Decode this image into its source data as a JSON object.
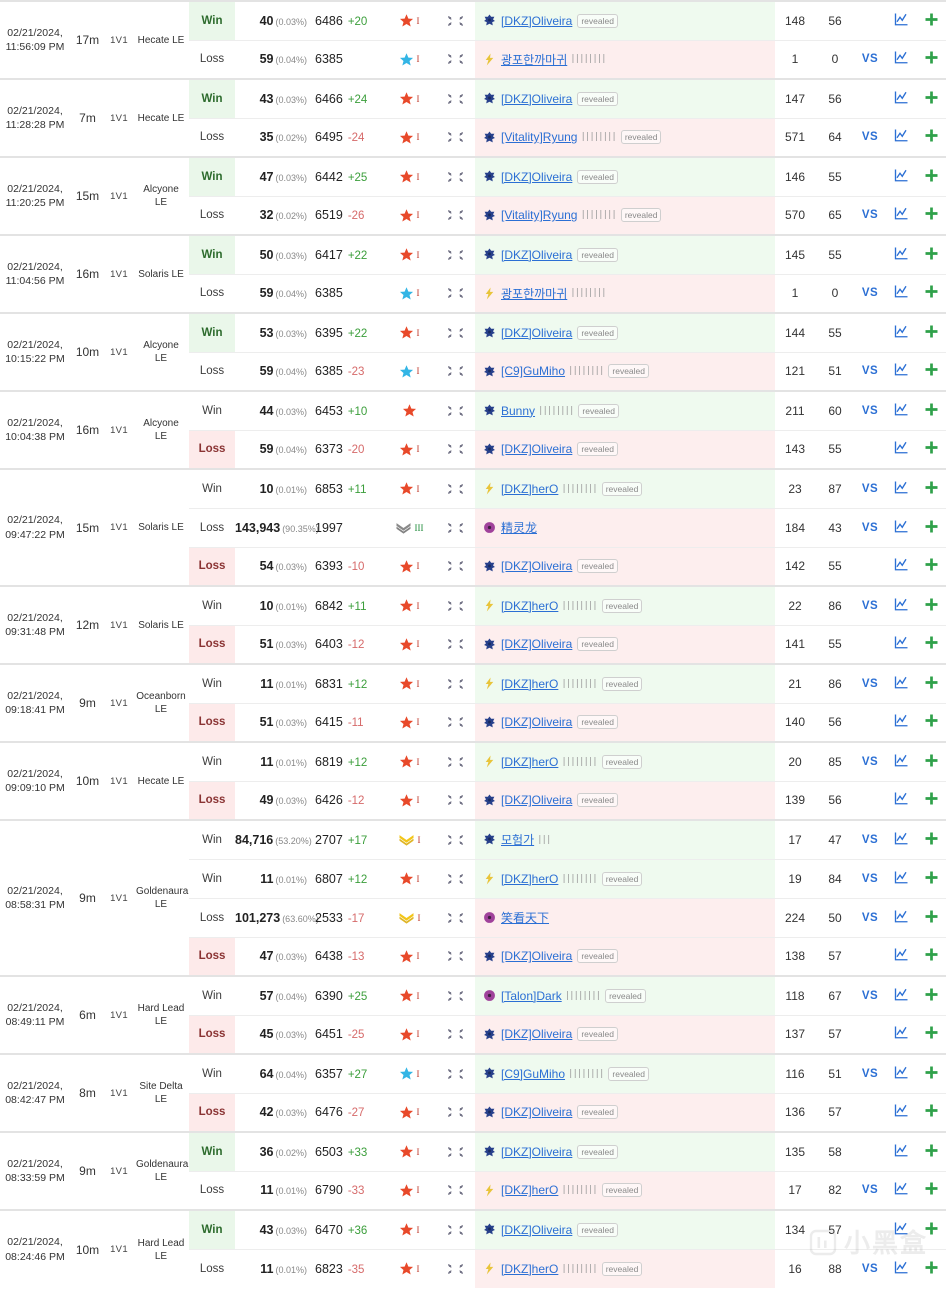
{
  "labels": {
    "win": "Win",
    "loss": "Loss",
    "mode": "1V1",
    "vs": "VS",
    "revealed": "revealed",
    "bars": "||||||||||",
    "bars_short": "|||"
  },
  "colors": {
    "win_bg": "#eaf7ea",
    "loss_bg": "#fdeaea",
    "link": "#2b6fd4",
    "mmr_up": "#3b9e3b",
    "mmr_down": "#d66a6a",
    "grandmaster": "#e8492a",
    "master": "#33b5e5",
    "gold": "#f2c518",
    "silver": "#8a8a8a",
    "add": "#2fa14a"
  },
  "watermark": {
    "text": "小黑盒"
  },
  "matches": [
    {
      "date": "02/21/2024, 11:56:09 PM",
      "duration": "17m",
      "mode": "1V1",
      "map": "Hecate LE",
      "rows": [
        {
          "result": "Win",
          "result_style": "win",
          "rank": "40",
          "pct": "(0.03%)",
          "mmr": "6486",
          "delta": "+20",
          "league": "grandmaster",
          "tier": "I",
          "tier_color": "red",
          "flag": "kr",
          "race": "terran",
          "player": "[DKZ]Oliveira",
          "bars": "",
          "revealed": true,
          "games": "148",
          "winrate": "56",
          "vs": false,
          "player_bg": "win"
        },
        {
          "result": "Loss",
          "result_style": "plain",
          "rank": "59",
          "pct": "(0.04%)",
          "mmr": "6385",
          "delta": "",
          "league": "master",
          "tier": "I",
          "tier_color": "red",
          "flag": "kr",
          "race": "protoss",
          "player": "광포한까마귀",
          "bars": "||||||||",
          "revealed": false,
          "games": "1",
          "winrate": "0",
          "vs": true,
          "player_bg": "loss"
        }
      ]
    },
    {
      "date": "02/21/2024, 11:28:28 PM",
      "duration": "7m",
      "mode": "1V1",
      "map": "Hecate LE",
      "rows": [
        {
          "result": "Win",
          "result_style": "win",
          "rank": "43",
          "pct": "(0.03%)",
          "mmr": "6466",
          "delta": "+24",
          "league": "grandmaster",
          "tier": "I",
          "tier_color": "red",
          "flag": "kr",
          "race": "terran",
          "player": "[DKZ]Oliveira",
          "bars": "",
          "revealed": true,
          "games": "147",
          "winrate": "56",
          "vs": false,
          "player_bg": "win"
        },
        {
          "result": "Loss",
          "result_style": "plain",
          "rank": "35",
          "pct": "(0.02%)",
          "mmr": "6495",
          "delta": "-24",
          "league": "grandmaster",
          "tier": "I",
          "tier_color": "red",
          "flag": "kr",
          "race": "terran",
          "player": "[Vitality]Ryung",
          "bars": "||||||||",
          "revealed": true,
          "games": "571",
          "winrate": "64",
          "vs": true,
          "player_bg": "loss"
        }
      ]
    },
    {
      "date": "02/21/2024, 11:20:25 PM",
      "duration": "15m",
      "mode": "1V1",
      "map": "Alcyone LE",
      "rows": [
        {
          "result": "Win",
          "result_style": "win",
          "rank": "47",
          "pct": "(0.03%)",
          "mmr": "6442",
          "delta": "+25",
          "league": "grandmaster",
          "tier": "I",
          "tier_color": "red",
          "flag": "kr",
          "race": "terran",
          "player": "[DKZ]Oliveira",
          "bars": "",
          "revealed": true,
          "games": "146",
          "winrate": "55",
          "vs": false,
          "player_bg": "win"
        },
        {
          "result": "Loss",
          "result_style": "plain",
          "rank": "32",
          "pct": "(0.02%)",
          "mmr": "6519",
          "delta": "-26",
          "league": "grandmaster",
          "tier": "I",
          "tier_color": "red",
          "flag": "kr",
          "race": "terran",
          "player": "[Vitality]Ryung",
          "bars": "||||||||",
          "revealed": true,
          "games": "570",
          "winrate": "65",
          "vs": true,
          "player_bg": "loss"
        }
      ]
    },
    {
      "date": "02/21/2024, 11:04:56 PM",
      "duration": "16m",
      "mode": "1V1",
      "map": "Solaris LE",
      "rows": [
        {
          "result": "Win",
          "result_style": "win",
          "rank": "50",
          "pct": "(0.03%)",
          "mmr": "6417",
          "delta": "+22",
          "league": "grandmaster",
          "tier": "I",
          "tier_color": "red",
          "flag": "kr",
          "race": "terran",
          "player": "[DKZ]Oliveira",
          "bars": "",
          "revealed": true,
          "games": "145",
          "winrate": "55",
          "vs": false,
          "player_bg": "win"
        },
        {
          "result": "Loss",
          "result_style": "plain",
          "rank": "59",
          "pct": "(0.04%)",
          "mmr": "6385",
          "delta": "",
          "league": "master",
          "tier": "I",
          "tier_color": "red",
          "flag": "kr",
          "race": "protoss",
          "player": "광포한까마귀",
          "bars": "||||||||",
          "revealed": false,
          "games": "1",
          "winrate": "0",
          "vs": true,
          "player_bg": "loss"
        }
      ]
    },
    {
      "date": "02/21/2024, 10:15:22 PM",
      "duration": "10m",
      "mode": "1V1",
      "map": "Alcyone LE",
      "rows": [
        {
          "result": "Win",
          "result_style": "win",
          "rank": "53",
          "pct": "(0.03%)",
          "mmr": "6395",
          "delta": "+22",
          "league": "grandmaster",
          "tier": "I",
          "tier_color": "red",
          "flag": "kr",
          "race": "terran",
          "player": "[DKZ]Oliveira",
          "bars": "",
          "revealed": true,
          "games": "144",
          "winrate": "55",
          "vs": false,
          "player_bg": "win"
        },
        {
          "result": "Loss",
          "result_style": "plain",
          "rank": "59",
          "pct": "(0.04%)",
          "mmr": "6385",
          "delta": "-23",
          "league": "master",
          "tier": "I",
          "tier_color": "red",
          "flag": "kr",
          "race": "terran",
          "player": "[C9]GuMiho",
          "bars": "||||||||",
          "revealed": true,
          "games": "121",
          "winrate": "51",
          "vs": true,
          "player_bg": "loss"
        }
      ]
    },
    {
      "date": "02/21/2024, 10:04:38 PM",
      "duration": "16m",
      "mode": "1V1",
      "map": "Alcyone LE",
      "rows": [
        {
          "result": "Win",
          "result_style": "plain",
          "rank": "44",
          "pct": "(0.03%)",
          "mmr": "6453",
          "delta": "+10",
          "league": "grandmaster",
          "tier": "",
          "tier_color": "red",
          "flag": "kr",
          "race": "terran",
          "player": "Bunny",
          "bars": "||||||||",
          "revealed": true,
          "games": "211",
          "winrate": "60",
          "vs": true,
          "player_bg": "win"
        },
        {
          "result": "Loss",
          "result_style": "loss",
          "rank": "59",
          "pct": "(0.04%)",
          "mmr": "6373",
          "delta": "-20",
          "league": "grandmaster",
          "tier": "I",
          "tier_color": "red",
          "flag": "kr",
          "race": "terran",
          "player": "[DKZ]Oliveira",
          "bars": "",
          "revealed": true,
          "games": "143",
          "winrate": "55",
          "vs": false,
          "player_bg": "loss"
        }
      ]
    },
    {
      "date": "02/21/2024, 09:47:22 PM",
      "duration": "15m",
      "mode": "1V1",
      "map": "Solaris LE",
      "rows": [
        {
          "result": "Win",
          "result_style": "plain",
          "rank": "10",
          "pct": "(0.01%)",
          "mmr": "6853",
          "delta": "+11",
          "league": "grandmaster",
          "tier": "I",
          "tier_color": "red",
          "flag": "kr",
          "race": "protoss",
          "player": "[DKZ]herO",
          "bars": "||||||||",
          "revealed": true,
          "games": "23",
          "winrate": "87",
          "vs": true,
          "player_bg": "win"
        },
        {
          "result": "Loss",
          "result_style": "plain",
          "rank": "143,943",
          "pct": "(90.35%)",
          "mmr": "1997",
          "delta": "",
          "league": "silver",
          "tier": "III",
          "tier_color": "green",
          "flag": "kr",
          "race": "zerg",
          "player": "精灵龙",
          "bars": "",
          "revealed": false,
          "games": "184",
          "winrate": "43",
          "vs": true,
          "player_bg": "loss"
        },
        {
          "result": "Loss",
          "result_style": "loss",
          "rank": "54",
          "pct": "(0.03%)",
          "mmr": "6393",
          "delta": "-10",
          "league": "grandmaster",
          "tier": "I",
          "tier_color": "red",
          "flag": "kr",
          "race": "terran",
          "player": "[DKZ]Oliveira",
          "bars": "",
          "revealed": true,
          "games": "142",
          "winrate": "55",
          "vs": false,
          "player_bg": "loss"
        }
      ]
    },
    {
      "date": "02/21/2024, 09:31:48 PM",
      "duration": "12m",
      "mode": "1V1",
      "map": "Solaris LE",
      "rows": [
        {
          "result": "Win",
          "result_style": "plain",
          "rank": "10",
          "pct": "(0.01%)",
          "mmr": "6842",
          "delta": "+11",
          "league": "grandmaster",
          "tier": "I",
          "tier_color": "red",
          "flag": "kr",
          "race": "protoss",
          "player": "[DKZ]herO",
          "bars": "||||||||",
          "revealed": true,
          "games": "22",
          "winrate": "86",
          "vs": true,
          "player_bg": "win"
        },
        {
          "result": "Loss",
          "result_style": "loss",
          "rank": "51",
          "pct": "(0.03%)",
          "mmr": "6403",
          "delta": "-12",
          "league": "grandmaster",
          "tier": "I",
          "tier_color": "red",
          "flag": "kr",
          "race": "terran",
          "player": "[DKZ]Oliveira",
          "bars": "",
          "revealed": true,
          "games": "141",
          "winrate": "55",
          "vs": false,
          "player_bg": "loss"
        }
      ]
    },
    {
      "date": "02/21/2024, 09:18:41 PM",
      "duration": "9m",
      "mode": "1V1",
      "map": "Oceanborn LE",
      "rows": [
        {
          "result": "Win",
          "result_style": "plain",
          "rank": "11",
          "pct": "(0.01%)",
          "mmr": "6831",
          "delta": "+12",
          "league": "grandmaster",
          "tier": "I",
          "tier_color": "red",
          "flag": "kr",
          "race": "protoss",
          "player": "[DKZ]herO",
          "bars": "||||||||",
          "revealed": true,
          "games": "21",
          "winrate": "86",
          "vs": true,
          "player_bg": "win"
        },
        {
          "result": "Loss",
          "result_style": "loss",
          "rank": "51",
          "pct": "(0.03%)",
          "mmr": "6415",
          "delta": "-11",
          "league": "grandmaster",
          "tier": "I",
          "tier_color": "red",
          "flag": "kr",
          "race": "terran",
          "player": "[DKZ]Oliveira",
          "bars": "",
          "revealed": true,
          "games": "140",
          "winrate": "56",
          "vs": false,
          "player_bg": "loss"
        }
      ]
    },
    {
      "date": "02/21/2024, 09:09:10 PM",
      "duration": "10m",
      "mode": "1V1",
      "map": "Hecate LE",
      "rows": [
        {
          "result": "Win",
          "result_style": "plain",
          "rank": "11",
          "pct": "(0.01%)",
          "mmr": "6819",
          "delta": "+12",
          "league": "grandmaster",
          "tier": "I",
          "tier_color": "red",
          "flag": "kr",
          "race": "protoss",
          "player": "[DKZ]herO",
          "bars": "||||||||",
          "revealed": true,
          "games": "20",
          "winrate": "85",
          "vs": true,
          "player_bg": "win"
        },
        {
          "result": "Loss",
          "result_style": "loss",
          "rank": "49",
          "pct": "(0.03%)",
          "mmr": "6426",
          "delta": "-12",
          "league": "grandmaster",
          "tier": "I",
          "tier_color": "red",
          "flag": "kr",
          "race": "terran",
          "player": "[DKZ]Oliveira",
          "bars": "",
          "revealed": true,
          "games": "139",
          "winrate": "56",
          "vs": false,
          "player_bg": "loss"
        }
      ]
    },
    {
      "date": "02/21/2024, 08:58:31 PM",
      "duration": "9m",
      "mode": "1V1",
      "map": "Goldenaura LE",
      "rows": [
        {
          "result": "Win",
          "result_style": "plain",
          "rank": "84,716",
          "pct": "(53.20%)",
          "mmr": "2707",
          "delta": "+17",
          "league": "gold",
          "tier": "I",
          "tier_color": "red",
          "flag": "kr",
          "race": "terran",
          "player": "모험가",
          "bars": "|||",
          "revealed": false,
          "games": "17",
          "winrate": "47",
          "vs": true,
          "player_bg": "win"
        },
        {
          "result": "Win",
          "result_style": "plain",
          "rank": "11",
          "pct": "(0.01%)",
          "mmr": "6807",
          "delta": "+12",
          "league": "grandmaster",
          "tier": "I",
          "tier_color": "red",
          "flag": "kr",
          "race": "protoss",
          "player": "[DKZ]herO",
          "bars": "||||||||",
          "revealed": true,
          "games": "19",
          "winrate": "84",
          "vs": true,
          "player_bg": "win"
        },
        {
          "result": "Loss",
          "result_style": "plain",
          "rank": "101,273",
          "pct": "(63.60%)",
          "mmr": "2533",
          "delta": "-17",
          "league": "gold",
          "tier": "I",
          "tier_color": "red",
          "flag": "kr",
          "race": "zerg",
          "player": "笑看天下",
          "bars": "",
          "revealed": false,
          "games": "224",
          "winrate": "50",
          "vs": true,
          "player_bg": "loss"
        },
        {
          "result": "Loss",
          "result_style": "loss",
          "rank": "47",
          "pct": "(0.03%)",
          "mmr": "6438",
          "delta": "-13",
          "league": "grandmaster",
          "tier": "I",
          "tier_color": "red",
          "flag": "kr",
          "race": "terran",
          "player": "[DKZ]Oliveira",
          "bars": "",
          "revealed": true,
          "games": "138",
          "winrate": "57",
          "vs": false,
          "player_bg": "loss"
        }
      ]
    },
    {
      "date": "02/21/2024, 08:49:11 PM",
      "duration": "6m",
      "mode": "1V1",
      "map": "Hard Lead LE",
      "rows": [
        {
          "result": "Win",
          "result_style": "plain",
          "rank": "57",
          "pct": "(0.04%)",
          "mmr": "6390",
          "delta": "+25",
          "league": "grandmaster",
          "tier": "I",
          "tier_color": "red",
          "flag": "kr",
          "race": "zerg",
          "player": "[Talon]Dark",
          "bars": "||||||||",
          "revealed": true,
          "games": "118",
          "winrate": "67",
          "vs": true,
          "player_bg": "win"
        },
        {
          "result": "Loss",
          "result_style": "loss",
          "rank": "45",
          "pct": "(0.03%)",
          "mmr": "6451",
          "delta": "-25",
          "league": "grandmaster",
          "tier": "I",
          "tier_color": "red",
          "flag": "kr",
          "race": "terran",
          "player": "[DKZ]Oliveira",
          "bars": "",
          "revealed": true,
          "games": "137",
          "winrate": "57",
          "vs": false,
          "player_bg": "loss"
        }
      ]
    },
    {
      "date": "02/21/2024, 08:42:47 PM",
      "duration": "8m",
      "mode": "1V1",
      "map": "Site Delta LE",
      "rows": [
        {
          "result": "Win",
          "result_style": "plain",
          "rank": "64",
          "pct": "(0.04%)",
          "mmr": "6357",
          "delta": "+27",
          "league": "master",
          "tier": "I",
          "tier_color": "red",
          "flag": "kr",
          "race": "terran",
          "player": "[C9]GuMiho",
          "bars": "||||||||",
          "revealed": true,
          "games": "116",
          "winrate": "51",
          "vs": true,
          "player_bg": "win"
        },
        {
          "result": "Loss",
          "result_style": "loss",
          "rank": "42",
          "pct": "(0.03%)",
          "mmr": "6476",
          "delta": "-27",
          "league": "grandmaster",
          "tier": "I",
          "tier_color": "red",
          "flag": "kr",
          "race": "terran",
          "player": "[DKZ]Oliveira",
          "bars": "",
          "revealed": true,
          "games": "136",
          "winrate": "57",
          "vs": false,
          "player_bg": "loss"
        }
      ]
    },
    {
      "date": "02/21/2024, 08:33:59 PM",
      "duration": "9m",
      "mode": "1V1",
      "map": "Goldenaura LE",
      "rows": [
        {
          "result": "Win",
          "result_style": "win",
          "rank": "36",
          "pct": "(0.02%)",
          "mmr": "6503",
          "delta": "+33",
          "league": "grandmaster",
          "tier": "I",
          "tier_color": "red",
          "flag": "kr",
          "race": "terran",
          "player": "[DKZ]Oliveira",
          "bars": "",
          "revealed": true,
          "games": "135",
          "winrate": "58",
          "vs": false,
          "player_bg": "win"
        },
        {
          "result": "Loss",
          "result_style": "plain",
          "rank": "11",
          "pct": "(0.01%)",
          "mmr": "6790",
          "delta": "-33",
          "league": "grandmaster",
          "tier": "I",
          "tier_color": "red",
          "flag": "kr",
          "race": "protoss",
          "player": "[DKZ]herO",
          "bars": "||||||||",
          "revealed": true,
          "games": "17",
          "winrate": "82",
          "vs": true,
          "player_bg": "loss"
        }
      ]
    },
    {
      "date": "02/21/2024, 08:24:46 PM",
      "duration": "10m",
      "mode": "1V1",
      "map": "Hard Lead LE",
      "rows": [
        {
          "result": "Win",
          "result_style": "win",
          "rank": "43",
          "pct": "(0.03%)",
          "mmr": "6470",
          "delta": "+36",
          "league": "grandmaster",
          "tier": "I",
          "tier_color": "red",
          "flag": "kr",
          "race": "terran",
          "player": "[DKZ]Oliveira",
          "bars": "",
          "revealed": true,
          "games": "134",
          "winrate": "57",
          "vs": false,
          "player_bg": "win"
        },
        {
          "result": "Loss",
          "result_style": "plain",
          "rank": "11",
          "pct": "(0.01%)",
          "mmr": "6823",
          "delta": "-35",
          "league": "grandmaster",
          "tier": "I",
          "tier_color": "red",
          "flag": "kr",
          "race": "protoss",
          "player": "[DKZ]herO",
          "bars": "||||||||",
          "revealed": true,
          "games": "16",
          "winrate": "88",
          "vs": true,
          "player_bg": "loss"
        }
      ]
    }
  ]
}
